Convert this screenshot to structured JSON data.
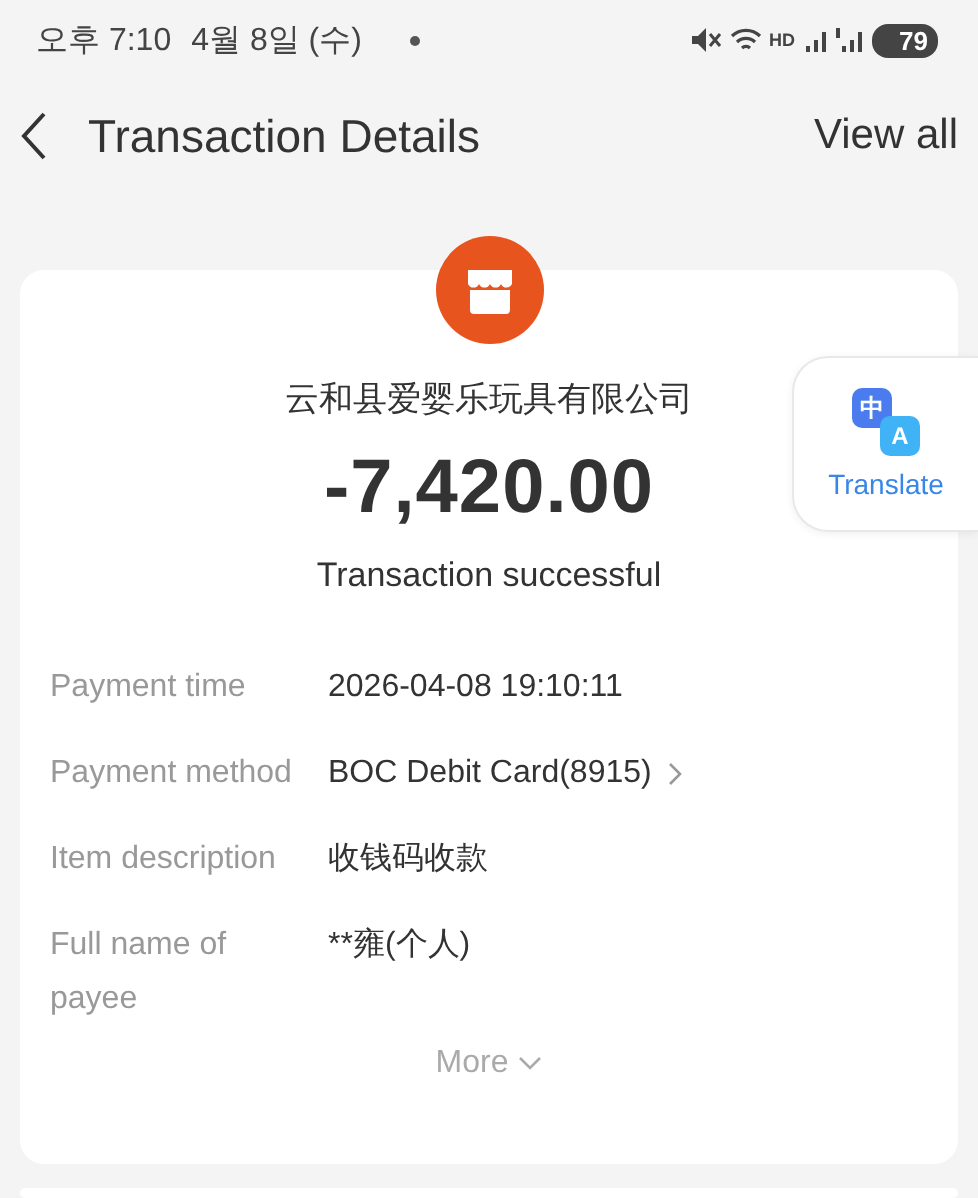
{
  "status_bar": {
    "time": "오후 7:10",
    "date": "4월 8일 (수)",
    "network": "HD",
    "battery": "79"
  },
  "header": {
    "title": "Transaction Details",
    "action": "View all"
  },
  "transaction": {
    "merchant": "云和县爱婴乐玩具有限公司",
    "amount": "-7,420.00",
    "status": "Transaction successful",
    "details": [
      {
        "label": "Payment time",
        "value": "2026-04-08 19:10:11",
        "has_arrow": false
      },
      {
        "label": "Payment method",
        "value": "BOC Debit Card(8915)",
        "has_arrow": true
      },
      {
        "label": "Item description",
        "value": "收钱码收款",
        "has_arrow": false
      },
      {
        "label": "Full name of payee",
        "value": "**雍(个人)",
        "has_arrow": false
      }
    ],
    "more": "More"
  },
  "translate_button": {
    "label": "Translate",
    "badge_top": "中",
    "badge_bottom": "A"
  }
}
